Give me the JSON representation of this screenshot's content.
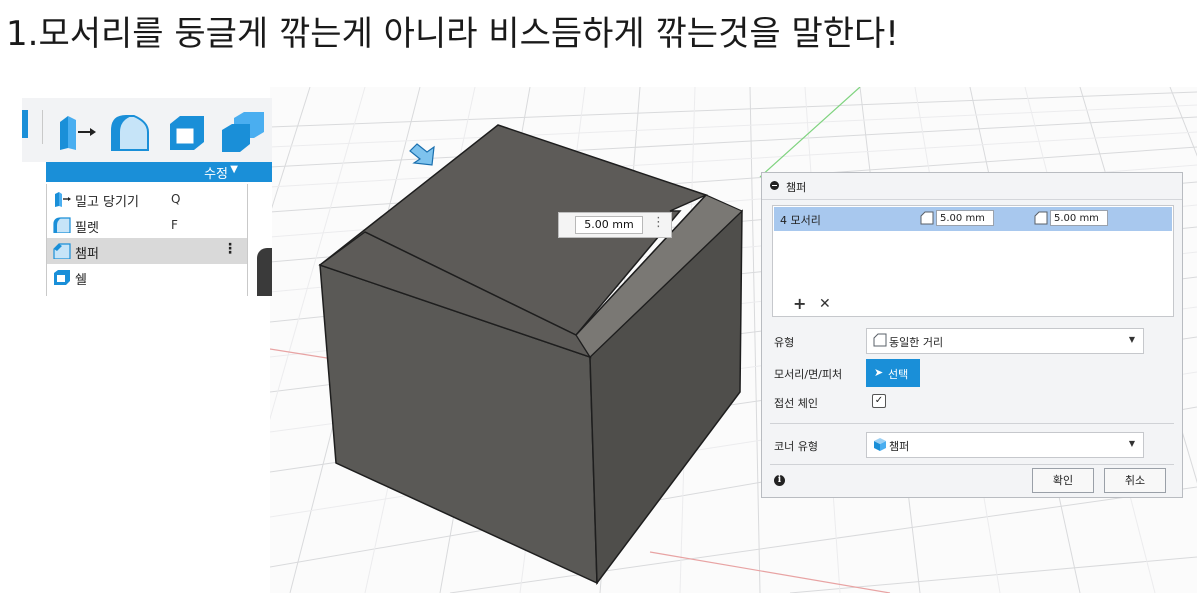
{
  "heading": "1.모서리를 둥글게 깎는게 아니라 비스듬하게 깎는것을 말한다!",
  "toolbar": {
    "modify_label": "수정",
    "icons": [
      "press-pull-icon",
      "fillet-icon",
      "shell-icon",
      "combine-icon"
    ],
    "menu": [
      {
        "label": "밀고 당기기",
        "shortcut": "Q",
        "icon": "press-pull-icon",
        "selected": false
      },
      {
        "label": "필렛",
        "shortcut": "F",
        "icon": "fillet-icon",
        "selected": false
      },
      {
        "label": "챔퍼",
        "shortcut": "",
        "icon": "chamfer-icon",
        "selected": true
      },
      {
        "label": "쉘",
        "shortcut": "",
        "icon": "shell-icon",
        "selected": false
      }
    ]
  },
  "canvas": {
    "dimension_value": "5.00 mm"
  },
  "panel": {
    "title": "챔퍼",
    "edge_row": {
      "label": "4 모서리",
      "distance1": "5.00 mm",
      "distance2": "5.00 mm"
    },
    "type_label": "유형",
    "type_value": "동일한 거리",
    "selection_label": "모서리/면/피처",
    "select_button": "선택",
    "tangent_label": "접선 체인",
    "tangent_checked": true,
    "corner_label": "코너 유형",
    "corner_value": "챔퍼",
    "ok_label": "확인",
    "cancel_label": "취소"
  },
  "colors": {
    "accent": "#1a8fd8",
    "row_highlight": "#a8c8ee",
    "cube_top": "#5d5b58",
    "cube_front": "#5a5956",
    "cube_side": "#4f4e4b",
    "chamfer_face": "#7a7874"
  }
}
